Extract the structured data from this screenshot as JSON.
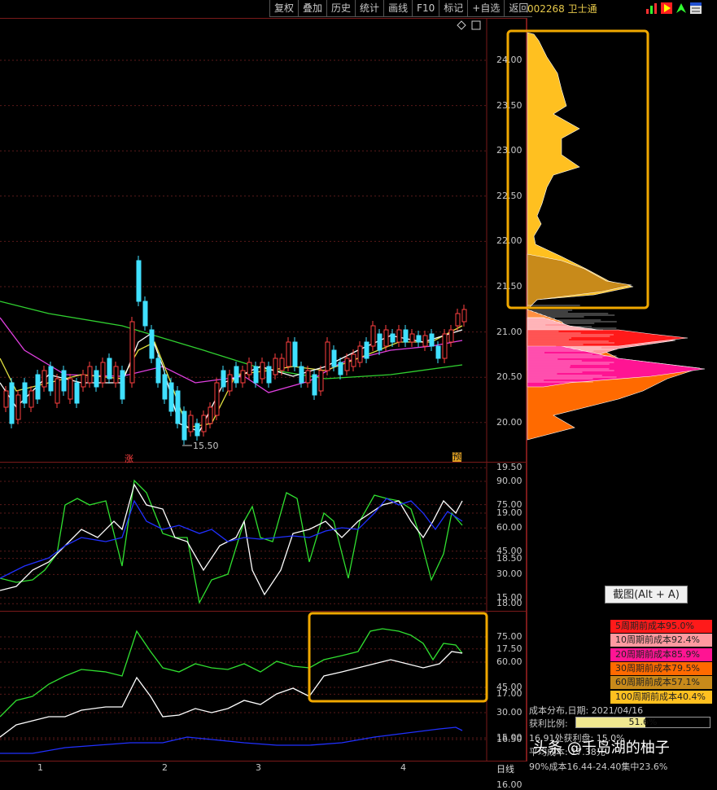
{
  "toolbar": {
    "buttons": [
      "复权",
      "叠加",
      "历史",
      "统计",
      "画线",
      "F10",
      "标记",
      "+自选",
      "返回"
    ]
  },
  "stock": {
    "code": "002268",
    "name": "卫士通"
  },
  "price_panel": {
    "y_ticks": [
      "24.00",
      "23.50",
      "23.00",
      "22.50",
      "22.00",
      "21.50",
      "21.00",
      "20.50",
      "20.00",
      "19.50",
      "19.00",
      "18.50",
      "18.00",
      "17.50",
      "17.00",
      "16.50",
      "16.00"
    ],
    "low_label": "15.50",
    "tag_left": "涨",
    "tag_right": "预"
  },
  "osc1": {
    "y_ticks": [
      "90.00",
      "75.00",
      "60.00",
      "45.00",
      "30.00",
      "15.00"
    ]
  },
  "osc2": {
    "y_ticks": [
      "75.00",
      "60.00",
      "45.00",
      "30.00",
      "15.00"
    ]
  },
  "x_axis": {
    "labels": [
      "1",
      "2",
      "3",
      "4"
    ],
    "period": "日线"
  },
  "screenshot_button": "截图(Alt + A)",
  "cost_legend": [
    {
      "label": "5周期前成本95.0%",
      "color": "#ff1a1a"
    },
    {
      "label": "10周期前成本92.4%",
      "color": "#ff9aa0"
    },
    {
      "label": "20周期前成本85.9%",
      "color": "#ff1493"
    },
    {
      "label": "30周期前成本79.5%",
      "color": "#ff6a00"
    },
    {
      "label": "60周期前成本57.1%",
      "color": "#c88a1a"
    },
    {
      "label": "100周期前成本40.4%",
      "color": "#ffc020"
    }
  ],
  "cost_info": {
    "date_line": "成本分布,日期:  2021/04/16",
    "profit_label": "获利比例:",
    "profit_value": "51.6%",
    "profit_fraction": 0.516,
    "line3": "16.91处获利盘:  15.0%",
    "line4": "平均成本:  17.38元",
    "line5": "90%成本16.44-24.40集中23.6%"
  },
  "watermark": "头条 @千岛湖的柚子",
  "colors": {
    "highlight": "#f0a800",
    "grid": "#5a1a1a",
    "up": "#ff4040",
    "down": "#40e0ff"
  }
}
